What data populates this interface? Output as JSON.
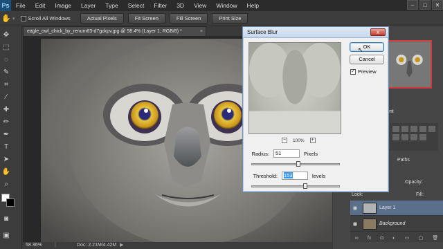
{
  "app": {
    "logo": "Ps"
  },
  "menu": [
    "File",
    "Edit",
    "Image",
    "Layer",
    "Type",
    "Select",
    "Filter",
    "3D",
    "View",
    "Window",
    "Help"
  ],
  "window_controls": [
    "–",
    "□",
    "✕"
  ],
  "options_bar": {
    "scroll_all_windows": "Scroll All Windows",
    "buttons": [
      "Actual Pixels",
      "Fit Screen",
      "Fill Screen",
      "Print Size"
    ]
  },
  "document": {
    "tab_title": "eagle_owl_chick_by_renum63-d7gckpv.jpg @ 58.4% (Layer 1, RGB/8) *",
    "close": "×"
  },
  "status": {
    "zoom": "58.36%",
    "doc_info": "Doc: 2.21M/4.42M"
  },
  "dialog": {
    "title": "Surface Blur",
    "close": "x",
    "ok": "OK",
    "cancel": "Cancel",
    "preview_label": "Preview",
    "preview_checked": true,
    "zoom": "100%",
    "zoom_minus": "−",
    "zoom_plus": "+",
    "radius_label": "Radius:",
    "radius_value": "51",
    "radius_unit": "Pixels",
    "threshold_label": "Threshold:",
    "threshold_value": "153",
    "threshold_unit": "levels",
    "radius_slider_fraction": 0.52,
    "threshold_slider_fraction": 0.6
  },
  "panels": {
    "paths_tab": "Paths",
    "ent_fragment": "ent",
    "opacity_label": "Opacity:",
    "fill_label": "Fill:",
    "lock_label": "Lock:"
  },
  "layers": [
    {
      "name": "Layer 1",
      "visible": true
    },
    {
      "name": "Background",
      "visible": true
    }
  ],
  "colors": {
    "accent_blue": "#3399ff",
    "nav_frame": "#d23a3a"
  }
}
